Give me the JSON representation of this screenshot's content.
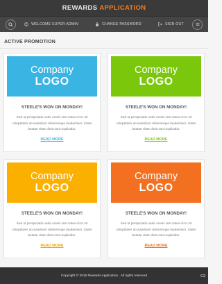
{
  "header": {
    "brand_part1": "REWARDS",
    "brand_part2": "APPLICATION"
  },
  "navbar": {
    "left_icon": "search-icon",
    "right_icon": "menu-icon",
    "items": [
      {
        "label": "WELCOME SUPER ADMIN",
        "icon": "user-icon"
      },
      {
        "label": "CHANGE PASSWORD",
        "icon": "lock-icon"
      },
      {
        "label": "SIGN OUT",
        "icon": "logout-icon"
      }
    ]
  },
  "main": {
    "section_title": "ACTIVE PROMOTION",
    "promotions": [
      {
        "logo_line1": "Company",
        "logo_line2": "LOGO",
        "logo_color": "#3ab4e3",
        "title": "STEELE'S WON ON MONDAY!",
        "body": "Sed ut perspiciatis unde omnis iste natus error sit voluptatem accusantium doloremque laudantium, totam  beatae vitae dicta sunt explicabo.",
        "link": "READ MORE",
        "link_color": "#3ab4e3"
      },
      {
        "logo_line1": "Company",
        "logo_line2": "LOGO",
        "logo_color": "#7ac70c",
        "title": "STEELE'S WON ON MONDAY!",
        "body": "Sed ut perspiciatis unde omnis iste natus error sit voluptatem accusantium doloremque laudantium, totam  beatae vitae dicta sunt explicabo.",
        "link": "READ MORE",
        "link_color": "#7ac70c"
      },
      {
        "logo_line1": "Company",
        "logo_line2": "LOGO",
        "logo_color": "#fbb000",
        "title": "STEELE'S WON ON MONDAY!",
        "body": "Sed ut perspiciatis unde omnis iste natus error sit voluptatem accusantium doloremque laudantium, totam  beatae vitae dicta sunt explicabo.",
        "link": "READ MORE",
        "link_color": "#f0a500"
      },
      {
        "logo_line1": "Company",
        "logo_line2": "LOGO",
        "logo_color": "#f37021",
        "title": "STEELE'S WON ON MONDAY!",
        "body": "Sed ut perspiciatis unde omnis iste natus error sit voluptatem accusantium doloremque laudantium, totam  beatae vitae dicta sunt explicabo.",
        "link": "READ MORE",
        "link_color": "#f37021"
      }
    ]
  },
  "footer": {
    "copyright": "Copyright © 2016 Rewards Application . All rights reserved",
    "corner_badge": "C2"
  }
}
